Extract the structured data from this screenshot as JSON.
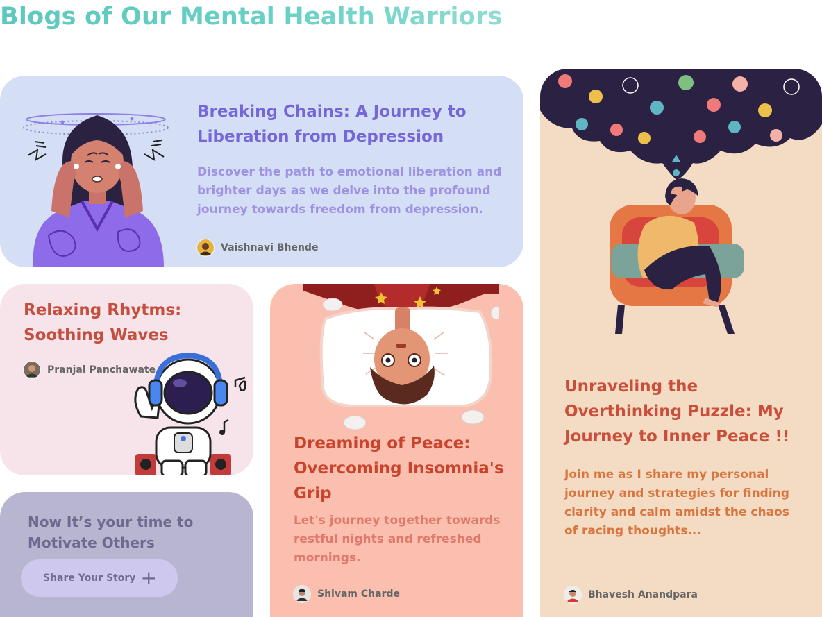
{
  "page": {
    "title": "Blogs of Our Mental Health Warriors"
  },
  "cards": [
    {
      "title": "Breaking Chains: A Journey to Liberation from Depression",
      "description": "Discover the path to emotional liberation and brighter days as we delve into the profound journey towards freedom from depression.",
      "author": "Vaishnavi Bhende",
      "background": "#d4def5",
      "title_color": "#7667d8"
    },
    {
      "title": "Relaxing Rhytms: Soothing Waves",
      "author": "Pranjal Panchawate",
      "background": "#f7e4ea",
      "title_color": "#c54f3e"
    },
    {
      "title": "Dreaming of Peace: Overcoming Insomnia's Grip",
      "description": "Let's journey together towards restful nights and refreshed mornings.",
      "author": "Shivam Charde",
      "background": "#fbbfb0",
      "title_color": "#c9442c"
    },
    {
      "title": "Unraveling the Overthinking Puzzle: My Journey to Inner Peace !!",
      "description": "Join me as I share my personal journey and strategies for finding clarity and calm amidst the chaos of racing thoughts...",
      "author": "Bhavesh Anandpara",
      "background": "#f4dcc4",
      "title_color": "#c94f3b"
    }
  ],
  "cta": {
    "heading": "Now It’s your time to Motivate Others",
    "button_label": "Share Your Story",
    "button_icon": "plus-icon"
  }
}
